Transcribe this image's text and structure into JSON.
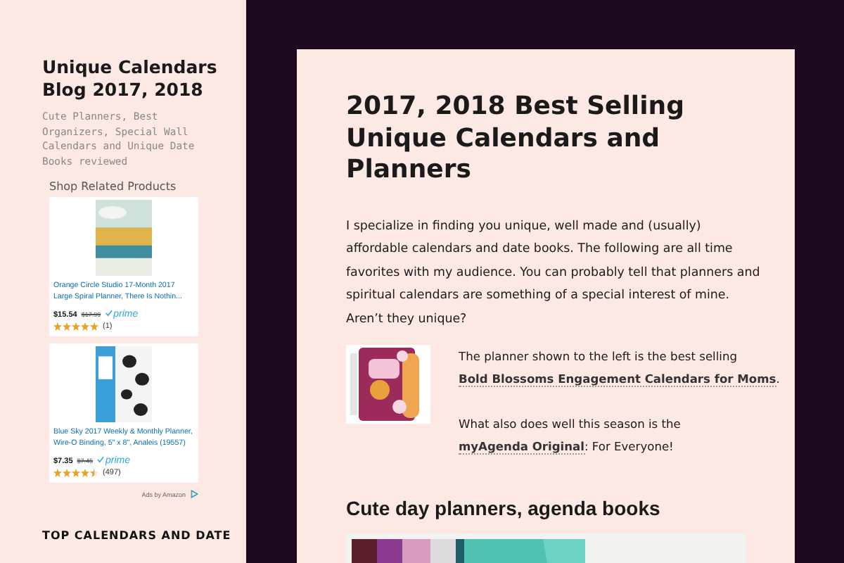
{
  "sidebar": {
    "site_title": "Unique Calendars Blog 2017, 2018",
    "tagline": "Cute Planners, Best Organizers, Special Wall Calendars and Unique Date Books reviewed",
    "ads": {
      "title": "Shop Related Products",
      "items": [
        {
          "kind": "picture",
          "title": "Orange Circle Studio 17-Month 2017 Large Spiral Planner, There Is Nothin...",
          "price": "$15.54",
          "old_price": "$17.99",
          "badge": "prime",
          "stars": 5,
          "count": "(1)"
        },
        {
          "kind": "picture",
          "title": "Blue Sky 2017 Weekly & Monthly Planner, Wire-O Binding, 5\" x 8\", Analeis (19557)",
          "price": "$7.35",
          "old_price": "$7.45",
          "badge": "prime",
          "stars": 4.5,
          "count": "(497)"
        }
      ],
      "footer": "Ads by Amazon"
    },
    "widget_title": "TOP CALENDARS AND DATE"
  },
  "main": {
    "title": "2017, 2018 Best Selling Unique Calendars and Planners",
    "intro": "I specialize in finding you unique, well made and (usually) affordable calendars and date books. The following are all time favorites with my audience. You can probably tell that planners and spiritual calendars are something of a special interest of mine. Aren’t they unique?",
    "feature": {
      "paragraphs": [
        [
          {
            "text": "The planner shown to the left is the best selling ",
            "link": false
          },
          {
            "text": "Bold Blossoms Engagement Calendars for Moms",
            "link": true
          },
          {
            "text": ".",
            "link": false
          }
        ],
        [
          {
            "text": "What also does well this season is the ",
            "link": false
          },
          {
            "text": "myAgenda Original",
            "link": true
          },
          {
            "text": ": For Everyone!",
            "link": false
          }
        ]
      ]
    },
    "section_heading": "Cute day planners, agenda books"
  }
}
